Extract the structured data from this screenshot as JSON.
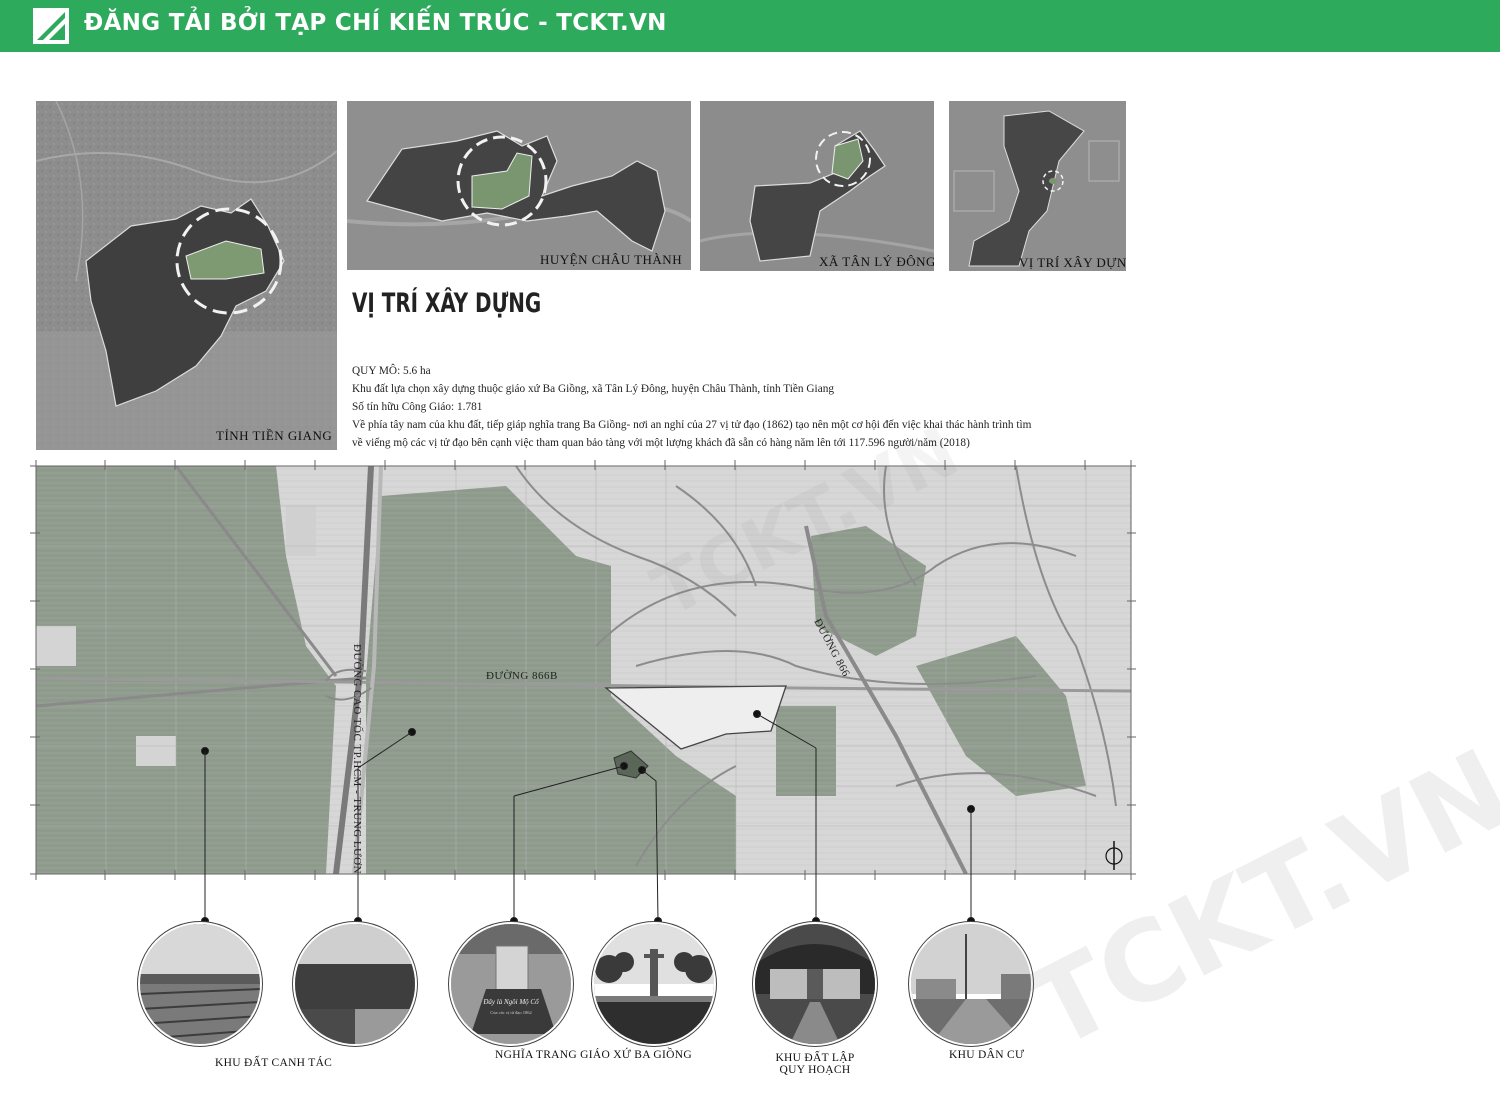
{
  "header": {
    "title": "ĐĂNG TẢI BỞI TẠP CHÍ KIẾN TRÚC - TCKT.VN",
    "bg_color": "#2eaa5c",
    "logo_icon": "tckt-logo-icon"
  },
  "panels": {
    "tinh_tien_giang": "TỈNH TIỀN GIANG",
    "huyen_chau_thanh": "HUYỆN CHÂU THÀNH",
    "xa_tan_ly_dong": "XÃ TÂN LÝ ĐÔNG",
    "vi_tri_xay_dung": "VỊ TRÍ XÂY DỰNG"
  },
  "section": {
    "title": "VỊ TRÍ XÂY DỰNG",
    "lines": [
      "QUY MÔ: 5.6 ha",
      "Khu đất lựa chọn xây dựng thuộc giáo xứ Ba Giồng,  xã Tân Lý Đông, huyện Châu Thành, tỉnh Tiền Giang",
      "Số tín hữu Công Giáo: 1.781",
      "Về phía tây nam của khu đất, tiếp giáp nghĩa trang Ba Giồng- nơi an nghỉ của 27 vị tử đạo (1862) tạo nên một cơ hội đến việc khai thác hành trình tìm",
      "về viếng mộ các vị tử đạo bên cạnh việc tham quan bảo tàng với một lượng khách đã sẵn có hàng năm lên tới 117.596 người/năm (2018)"
    ]
  },
  "map": {
    "road_866b": "ĐƯỜNG 866B",
    "road_866": "ĐƯỜNG 866",
    "expressway": "ĐƯỜNG CAO TỐC TP.HCM - TRUNG LƯƠNG",
    "north_icon": "north-arrow-icon",
    "colors": {
      "farmland": "#8e9a8c",
      "urban": "#d9d9d9",
      "site": "#eeeeee",
      "road": "#9a9a9a"
    }
  },
  "captions": {
    "khu_dat_canh_tac": "KHU ĐẤT CANH TÁC",
    "nghia_trang": "NGHĨA TRANG GIÁO XỨ BA GIỒNG",
    "khu_dat_lap_1": "KHU ĐẤT LẬP",
    "khu_dat_lap_2": "QUY HOẠCH",
    "khu_dan_cu": "KHU DÂN CƯ"
  },
  "photos": {
    "tomb_text_1": "Đây là Ngôi Mộ Cổ",
    "tomb_text_2": "Của các vị tử đạo 1862"
  },
  "watermark": "TCKT.VN"
}
